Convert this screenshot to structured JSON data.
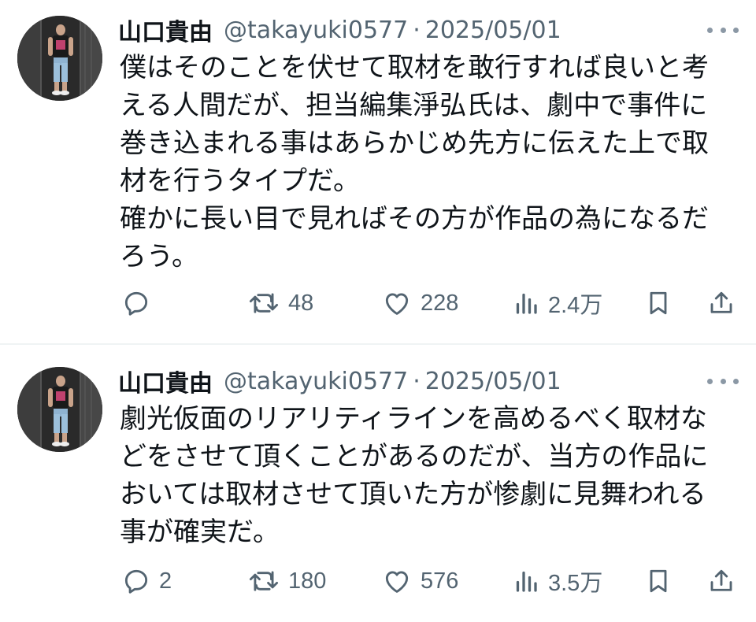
{
  "tweets": [
    {
      "author_name": "山口貴由",
      "handle": "@takayuki0577",
      "separator": "·",
      "date": "2025/05/01",
      "lines": [
        "僕はそのことを伏せて取材を敢行すれば良いと考",
        "える人間だが、担当編集淨弘氏は、劇中で事件に",
        "巻き込まれる事はあらかじめ先方に伝えた上で取",
        "材を行うタイプだ。",
        "確かに長い目で見ればその方が作品の為になるだ",
        "ろう。"
      ],
      "stats": {
        "replies": "",
        "retweets": "48",
        "likes": "228",
        "views": "2.4万"
      }
    },
    {
      "author_name": "山口貴由",
      "handle": "@takayuki0577",
      "separator": "·",
      "date": "2025/05/01",
      "lines": [
        "劇光仮面のリアリティラインを高めるべく取材な",
        "どをさせて頂くことがあるのだが、当方の作品に",
        "おいては取材させて頂いた方が惨劇に見舞われる",
        "事が確実だ。"
      ],
      "stats": {
        "replies": "2",
        "retweets": "180",
        "likes": "576",
        "views": "3.5万"
      }
    }
  ],
  "icons": [
    "more-icon",
    "reply-icon",
    "retweet-icon",
    "like-icon",
    "views-icon",
    "bookmark-icon",
    "share-icon"
  ],
  "colors": {
    "text": "#0f1419",
    "secondary": "#536471",
    "divider": "#eff3f4"
  }
}
